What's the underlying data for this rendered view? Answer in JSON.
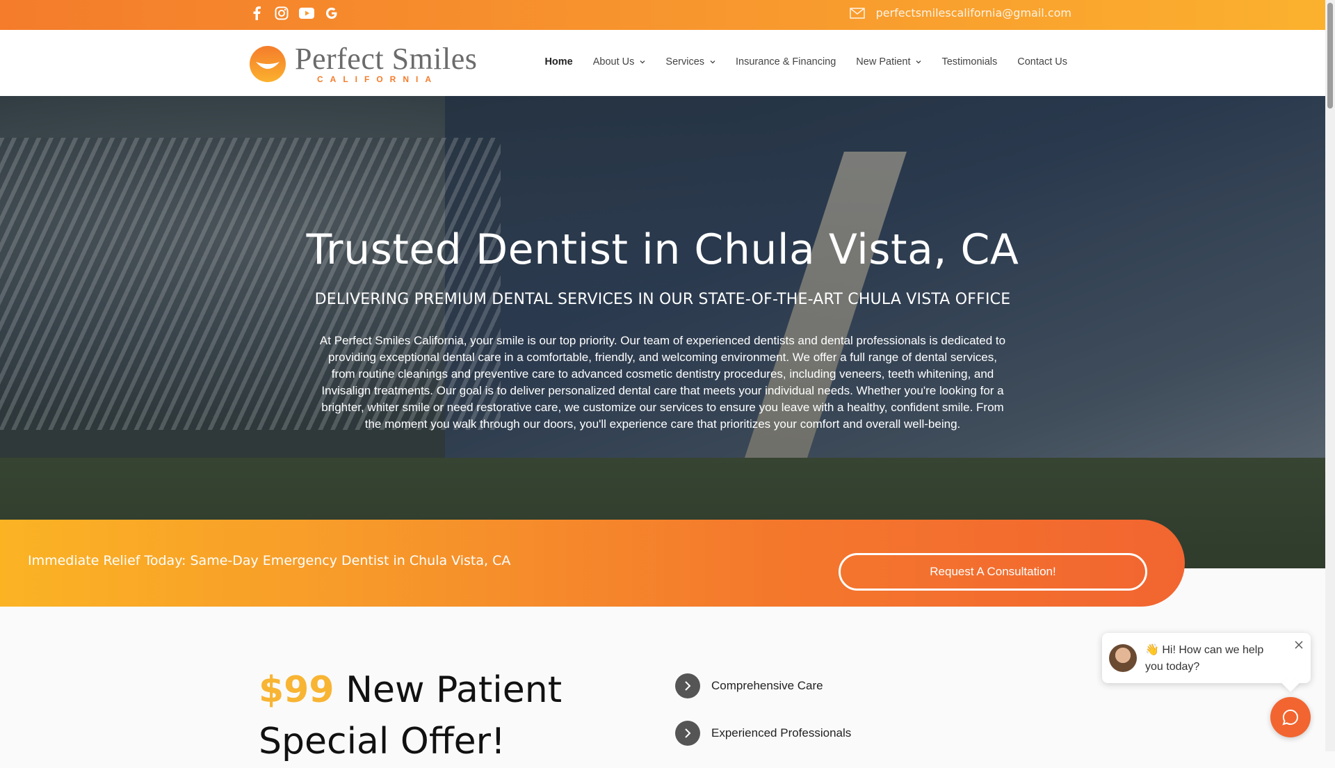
{
  "topbar": {
    "social": [
      {
        "name": "facebook-icon"
      },
      {
        "name": "instagram-icon"
      },
      {
        "name": "youtube-icon"
      },
      {
        "name": "google-icon"
      }
    ],
    "email": "perfectsmilescalifornia@gmail.com"
  },
  "logo": {
    "name": "Perfect Smiles",
    "sub": "CALIFORNIA"
  },
  "nav": {
    "home": "Home",
    "about": "About Us",
    "services": "Services",
    "insurance": "Insurance & Financing",
    "new_patient": "New Patient",
    "testimonials": "Testimonials",
    "contact": "Contact Us"
  },
  "hero": {
    "title": "Trusted Dentist in Chula Vista, CA",
    "subtitle": "DELIVERING PREMIUM DENTAL SERVICES IN OUR STATE-OF-THE-ART CHULA VISTA OFFICE",
    "body": "At Perfect Smiles California, your smile is our top priority. Our team of experienced dentists and dental professionals is dedicated to providing exceptional dental care in a comfortable, friendly, and welcoming environment. We offer a full range of dental services, from routine cleanings and preventive care to advanced cosmetic dentistry procedures, including veneers, teeth whitening, and Invisalign treatments. Our goal is to deliver personalized dental care that meets your individual needs. Whether you're looking for a brighter, whiter smile or need restorative care, we customize our services to ensure you leave with a healthy, confident smile. From the moment you walk through our doors, you'll experience care that prioritizes your comfort and overall well-being."
  },
  "cta": {
    "text": "Immediate Relief Today: Same-Day Emergency Dentist in Chula Vista, CA",
    "button": "Request A Consultation!"
  },
  "offer": {
    "price": "$99",
    "line1_rest": " New Patient",
    "line2": "Special Offer!"
  },
  "features": [
    "Comprehensive Care",
    "Experienced Professionals"
  ],
  "chat": {
    "message": "👋 Hi! How can we help you today?"
  },
  "colors": {
    "brand_orange": "#f47c2b",
    "accent_yellow": "#f8b433"
  }
}
